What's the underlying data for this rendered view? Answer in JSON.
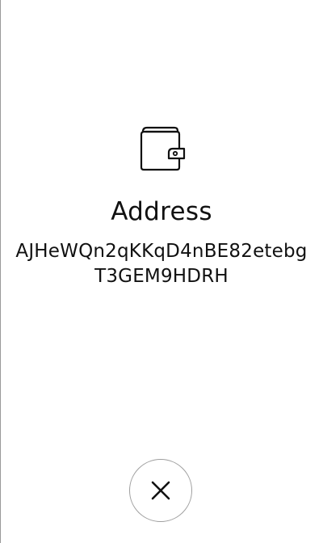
{
  "title": "Address",
  "address": "AJHeWQn2qKKqD4nBE82etebgT3GEM9HDRH",
  "icons": {
    "header": "wallet-icon",
    "close": "close-icon"
  },
  "colors": {
    "background": "#ffffff",
    "text": "#111111",
    "border": "#9e9e9e"
  }
}
